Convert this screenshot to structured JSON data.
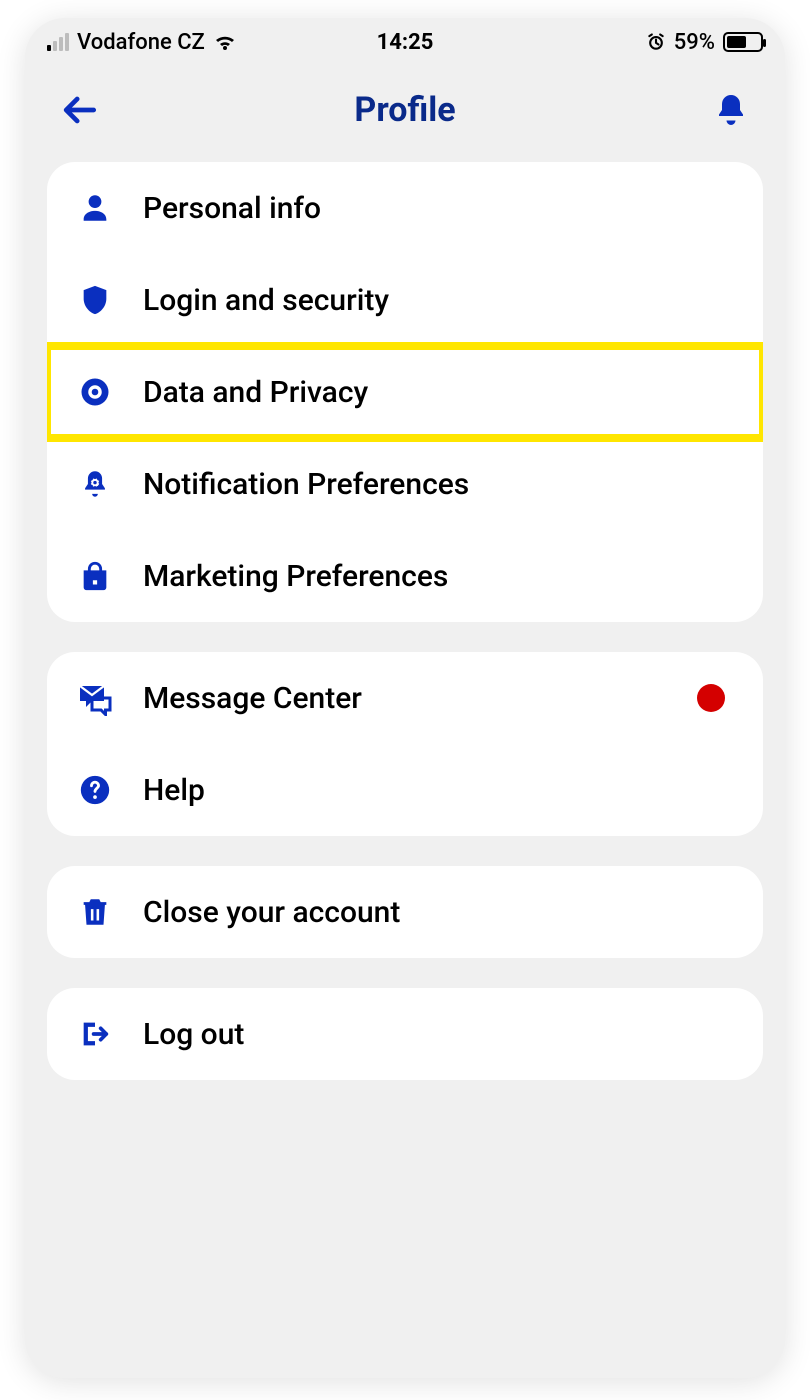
{
  "statusbar": {
    "carrier": "Vodafone CZ",
    "time": "14:25",
    "battery_pct": "59%"
  },
  "header": {
    "title": "Profile"
  },
  "colors": {
    "brand": "#0a2fbf",
    "highlight": "#ffe600",
    "dot": "#d40000"
  },
  "sections": [
    {
      "rows": [
        {
          "icon": "person-icon",
          "label": "Personal info"
        },
        {
          "icon": "shield-icon",
          "label": "Login and security"
        },
        {
          "icon": "eye-icon",
          "label": "Data and Privacy",
          "highlighted": true
        },
        {
          "icon": "bell-gear-icon",
          "label": "Notification Preferences"
        },
        {
          "icon": "bag-icon",
          "label": "Marketing Preferences"
        }
      ]
    },
    {
      "rows": [
        {
          "icon": "message-icon",
          "label": "Message Center",
          "has_dot": true
        },
        {
          "icon": "help-icon",
          "label": "Help"
        }
      ]
    },
    {
      "rows": [
        {
          "icon": "trash-icon",
          "label": "Close your account"
        }
      ]
    },
    {
      "rows": [
        {
          "icon": "logout-icon",
          "label": "Log out"
        }
      ]
    }
  ]
}
